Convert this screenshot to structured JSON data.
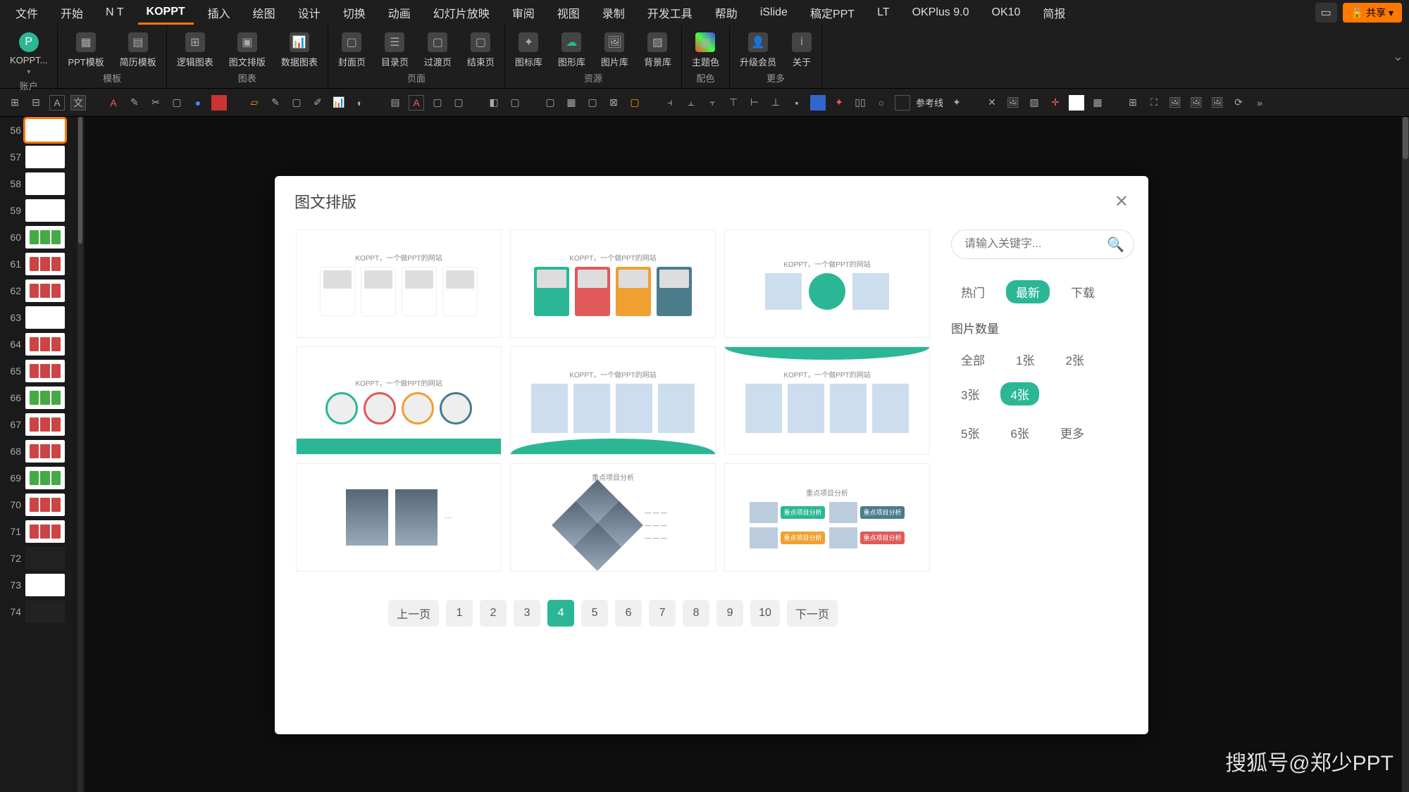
{
  "menu": {
    "items": [
      "文件",
      "开始",
      "N T",
      "KOPPT",
      "插入",
      "绘图",
      "设计",
      "切换",
      "动画",
      "幻灯片放映",
      "审阅",
      "视图",
      "录制",
      "开发工具",
      "帮助",
      "iSlide",
      "稿定PPT",
      "LT",
      "OKPlus 9.0",
      "OK10",
      "简报"
    ],
    "active": "KOPPT",
    "share": "共享"
  },
  "ribbon": {
    "groups": [
      {
        "title": "账户",
        "buttons": [
          {
            "label": "KOPPT..."
          }
        ]
      },
      {
        "title": "模板",
        "buttons": [
          {
            "label": "PPT模板"
          },
          {
            "label": "简历模板"
          }
        ]
      },
      {
        "title": "图表",
        "buttons": [
          {
            "label": "逻辑图表"
          },
          {
            "label": "图文排版"
          },
          {
            "label": "数据图表"
          }
        ]
      },
      {
        "title": "页面",
        "buttons": [
          {
            "label": "封面页"
          },
          {
            "label": "目录页"
          },
          {
            "label": "过渡页"
          },
          {
            "label": "结束页"
          }
        ]
      },
      {
        "title": "资源",
        "buttons": [
          {
            "label": "图标库"
          },
          {
            "label": "图形库"
          },
          {
            "label": "图片库"
          },
          {
            "label": "背景库"
          }
        ]
      },
      {
        "title": "配色",
        "buttons": [
          {
            "label": "主题色"
          }
        ]
      },
      {
        "title": "更多",
        "buttons": [
          {
            "label": "升级会员"
          },
          {
            "label": "关于"
          }
        ]
      }
    ]
  },
  "toolbar": {
    "guides_label": "参考线"
  },
  "thumbs": {
    "start": 56,
    "count": 19,
    "selected": 56
  },
  "dialog": {
    "title": "图文排版",
    "search_placeholder": "请输入关键字...",
    "sort": {
      "items": [
        "热门",
        "最新",
        "下载"
      ],
      "active": "最新"
    },
    "count_label": "图片数量",
    "counts": {
      "items": [
        "全部",
        "1张",
        "2张",
        "3张",
        "4张",
        "5张",
        "6张",
        "更多"
      ],
      "active": "4张"
    },
    "templates_caption": "KOPPT，一个做PPT的网站",
    "analysis_label": "重点项目分析",
    "pager": {
      "prev": "上一页",
      "next": "下一页",
      "pages": [
        "1",
        "2",
        "3",
        "4",
        "5",
        "6",
        "7",
        "8",
        "9",
        "10"
      ],
      "active": "4"
    }
  },
  "watermark": "搜狐号@郑少PPT"
}
